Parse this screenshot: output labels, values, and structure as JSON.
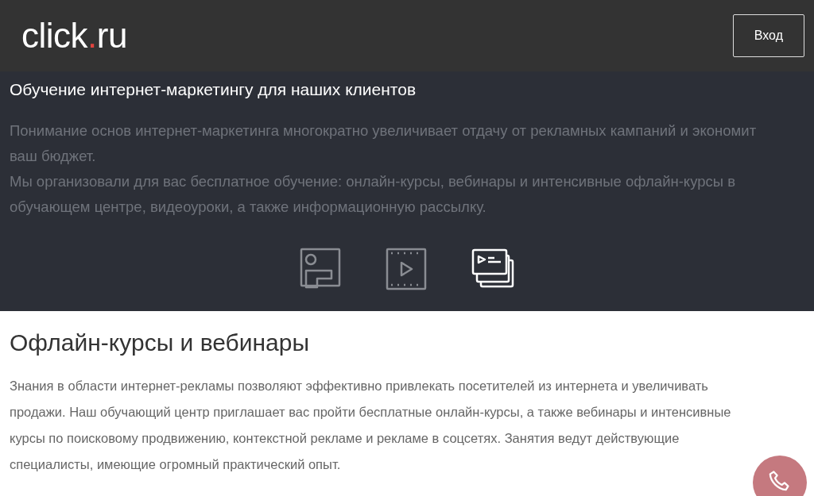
{
  "header": {
    "logo": [
      "click",
      ".",
      "ru"
    ],
    "login_button": "Вход"
  },
  "hero": {
    "title": "Обучение интернет-маркетингу для наших клиентов",
    "paragraphs": [
      "Понимание основ интернет-маркетинга многократно увеличивает отдачу от рекламных кампаний и экономит ваш бюджет.",
      "Мы организовали для вас бесплатное обучение: онлайн-курсы, вебинары и интенсивные офлайн-курсы в обучающем центре, видеоуроки, а также информационную рассылку."
    ],
    "tabs": [
      {
        "kind": "teacher",
        "selected": false
      },
      {
        "kind": "video",
        "selected": false
      },
      {
        "kind": "cards",
        "selected": true
      }
    ]
  },
  "section": {
    "title": "Офлайн-курсы и вебинары",
    "text": "Знания в области интернет-рекламы позволяют эффективно привлекать посетителей из интернета и увеличивать продажи. Наш обучающий центр приглашает вас пройти бесплатные онлайн-курсы, а также вебинары и интенсивные курсы по поисковому продвижению, контекстной рекламе и рекламе в соцсетях. Занятия ведут действующие специалисты, имеющие огромный практический опыт."
  }
}
